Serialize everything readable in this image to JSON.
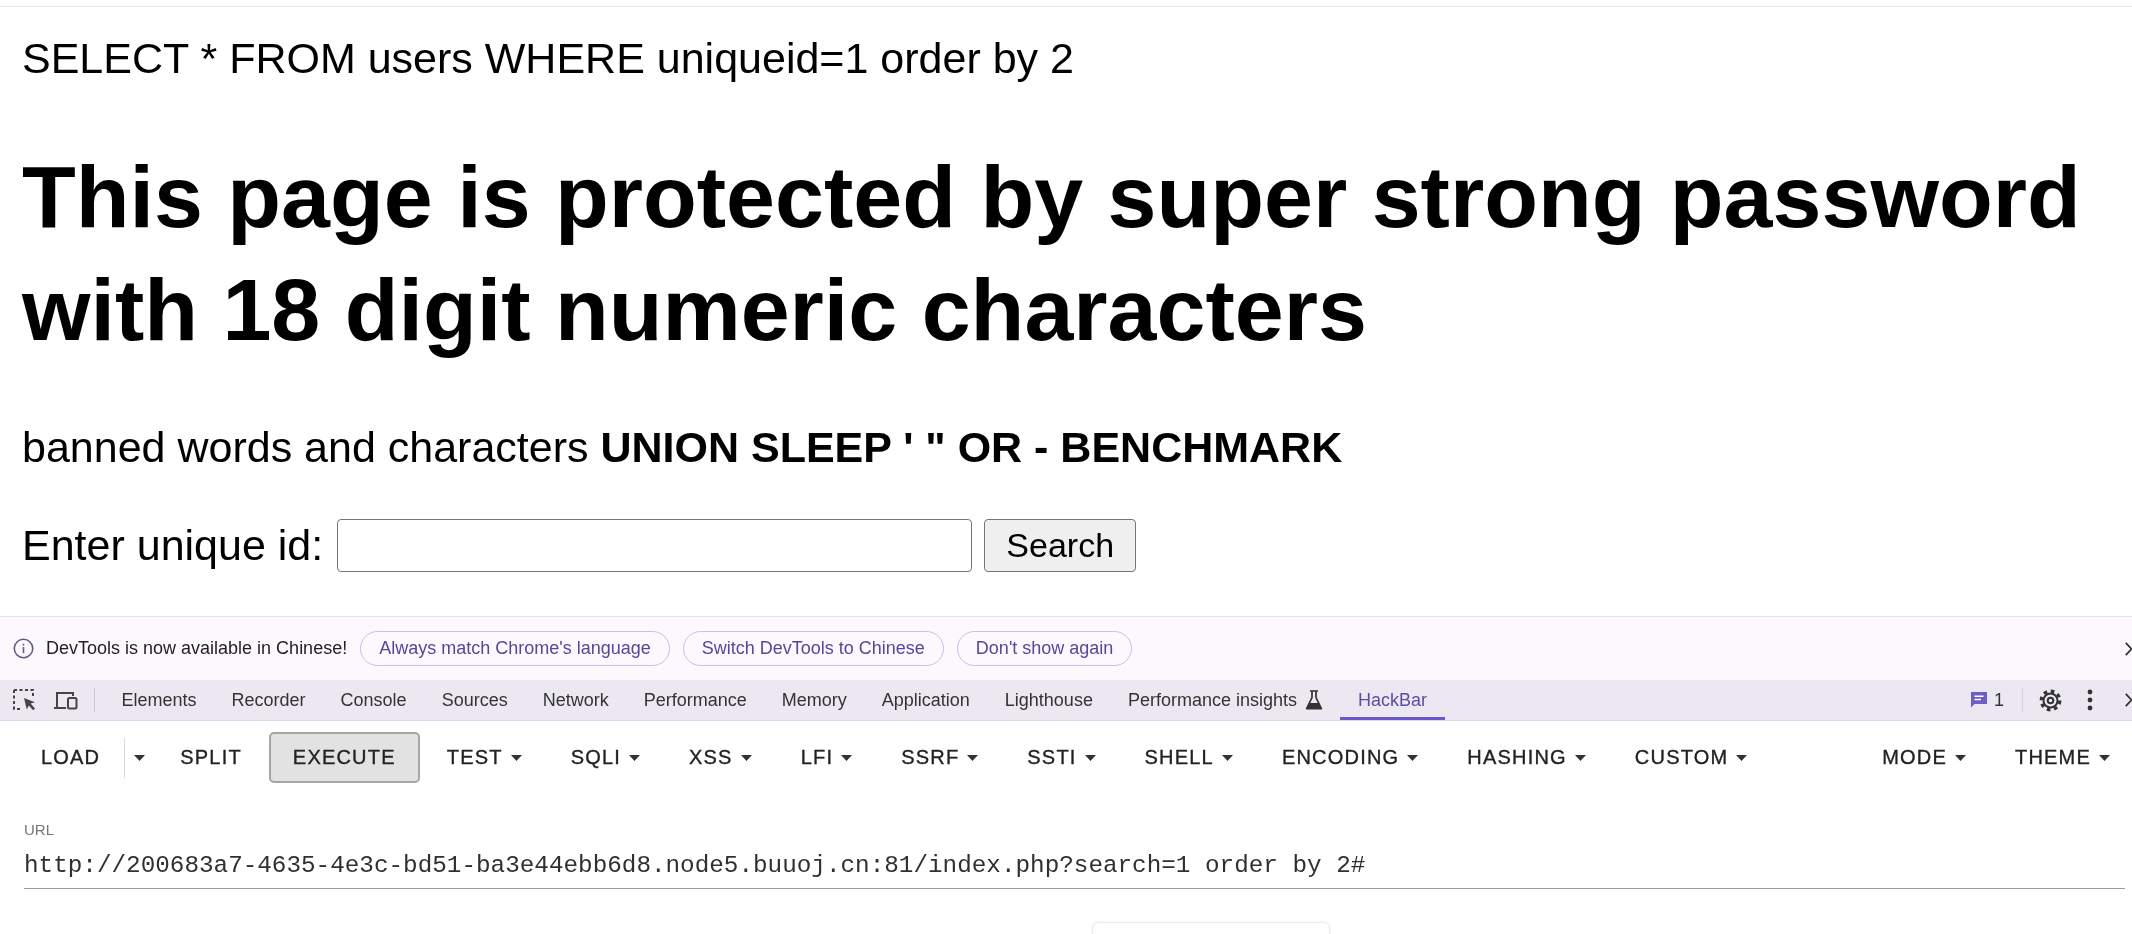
{
  "page": {
    "query": "SELECT * FROM users WHERE uniqueid=1 order by 2",
    "heading": "This page is protected by super strong password with 18 digit numeric characters",
    "banned": "banned words and characters **UNION SLEEP ' \" OR - BENCHMARK**",
    "form": {
      "label": "Enter unique id:",
      "button": "Search"
    }
  },
  "devtools": {
    "infobar": {
      "message": "DevTools is now available in Chinese!",
      "buttons": [
        "Always match Chrome's language",
        "Switch DevTools to Chinese",
        "Don't show again"
      ]
    },
    "tabs": [
      {
        "label": "Elements",
        "kind": "plain",
        "selected": false
      },
      {
        "label": "Recorder",
        "kind": "plain",
        "selected": false
      },
      {
        "label": "Console",
        "kind": "plain",
        "selected": false
      },
      {
        "label": "Sources",
        "kind": "plain",
        "selected": false
      },
      {
        "label": "Network",
        "kind": "plain",
        "selected": false
      },
      {
        "label": "Performance",
        "kind": "plain",
        "selected": false
      },
      {
        "label": "Memory",
        "kind": "plain",
        "selected": false
      },
      {
        "label": "Application",
        "kind": "plain",
        "selected": false
      },
      {
        "label": "Lighthouse",
        "kind": "plain",
        "selected": false
      },
      {
        "label": "Performance insights",
        "kind": "experimental",
        "selected": false
      },
      {
        "label": "HackBar",
        "kind": "plain",
        "selected": true
      }
    ],
    "issues_count": "1"
  },
  "hackbar": {
    "toolbar_left": [
      {
        "label": "LOAD",
        "kind": "split",
        "focused": false
      },
      {
        "label": "SPLIT",
        "kind": "plain",
        "focused": false
      },
      {
        "label": "EXECUTE",
        "kind": "plain",
        "focused": true
      },
      {
        "label": "TEST",
        "kind": "menu",
        "focused": false
      },
      {
        "label": "SQLI",
        "kind": "menu",
        "focused": false
      },
      {
        "label": "XSS",
        "kind": "menu",
        "focused": false
      },
      {
        "label": "LFI",
        "kind": "menu",
        "focused": false
      },
      {
        "label": "SSRF",
        "kind": "menu",
        "focused": false
      },
      {
        "label": "SSTI",
        "kind": "menu",
        "focused": false
      },
      {
        "label": "SHELL",
        "kind": "menu",
        "focused": false
      },
      {
        "label": "ENCODING",
        "kind": "menu",
        "focused": false
      },
      {
        "label": "HASHING",
        "kind": "menu",
        "focused": false
      },
      {
        "label": "CUSTOM",
        "kind": "menu",
        "focused": false
      }
    ],
    "toolbar_right": [
      {
        "label": "MODE",
        "kind": "menu",
        "focused": false
      },
      {
        "label": "THEME",
        "kind": "menu",
        "focused": false
      }
    ],
    "url": {
      "label": "URL",
      "value": "http://200683a7-4635-4e3c-bd51-ba3e44ebb6d8.node5.buuoj.cn:81/index.php?search=1 order by 2#"
    }
  }
}
